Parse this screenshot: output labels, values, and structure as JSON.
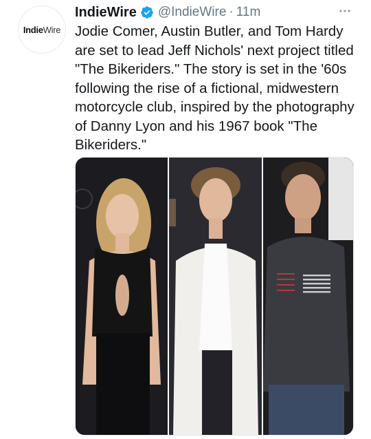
{
  "tweet": {
    "avatar_text_part1": "Indie",
    "avatar_text_part2": "Wire",
    "display_name": "IndieWire",
    "handle": "@IndieWire",
    "separator": "·",
    "time": "11m",
    "text": "Jodie Comer, Austin Butler, and Tom Hardy are set to lead Jeff Nichols' next project titled \"The Bikeriders.\" The story is set in the '60s following the rise of a fictional, midwestern motorcycle club, inspired by the photography of Danny Lyon and his 1967 book \"The Bikeriders.\""
  },
  "icons": {
    "verified": "verified-badge-icon",
    "more": "more-options-icon"
  },
  "colors": {
    "verified_blue": "#1da1f2",
    "secondary_text": "#657786"
  }
}
